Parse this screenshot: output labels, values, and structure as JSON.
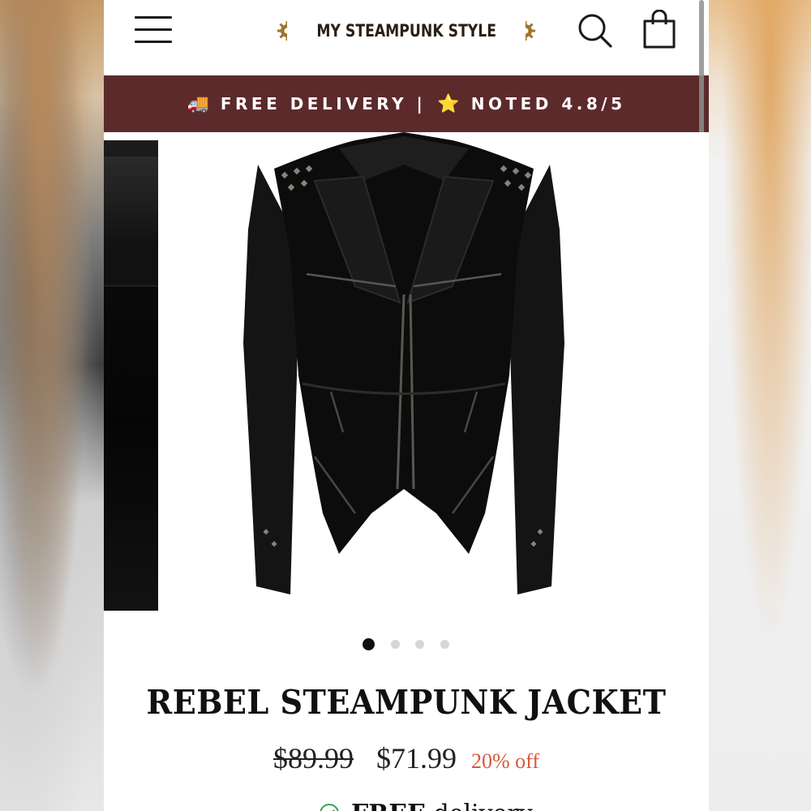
{
  "header": {
    "logo_text": "MY STEAMPUNK STYLE",
    "menu_icon": "hamburger-menu-icon",
    "search_icon": "search-icon",
    "cart_icon": "shopping-bag-icon"
  },
  "announcement": {
    "truck_emoji": "🚚",
    "delivery_text": "FREE DELIVERY |",
    "star_emoji": "⭐",
    "rating_text": "NOTED 4.8/5"
  },
  "gallery": {
    "slide_count": 4,
    "active_index": 0
  },
  "product": {
    "title": "REBEL STEAMPUNK JACKET",
    "original_price": "$89.99",
    "sale_price": "$71.99",
    "discount": "20% off",
    "delivery_strong": "FREE",
    "delivery_rest": " delivery"
  },
  "colors": {
    "announcement_bg": "#5c2a2b",
    "discount_text": "#d9583a",
    "check_green": "#3aa34a",
    "logo_brown": "#2a1e14",
    "logo_gear": "#a0732e"
  }
}
